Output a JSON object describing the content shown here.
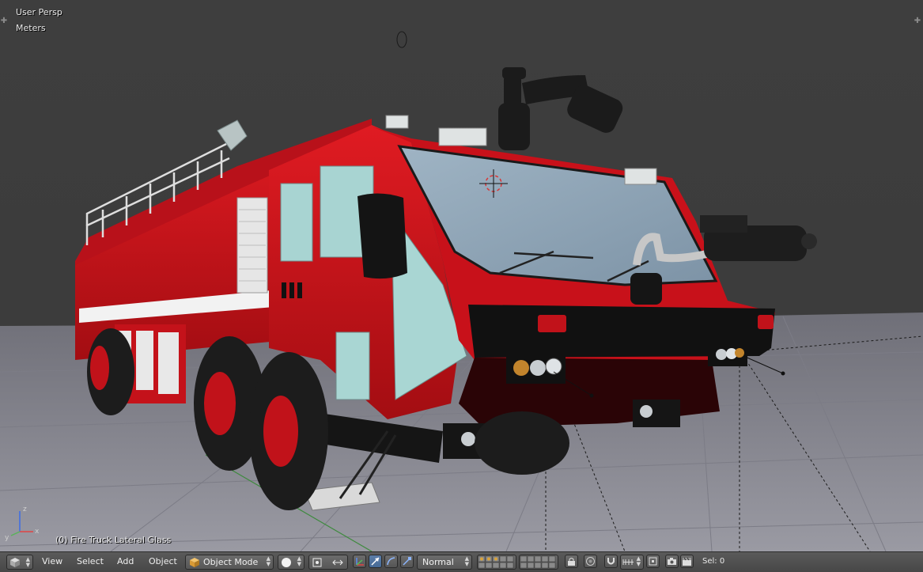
{
  "viewport": {
    "perspective_label": "User Persp",
    "units_label": "Meters",
    "object_label": "(0) Fire Truck Lateral Glass",
    "axis_labels": {
      "x": "x",
      "y": "y",
      "z": "z"
    }
  },
  "header": {
    "menu": {
      "view": "View",
      "select": "Select",
      "add": "Add",
      "object": "Object"
    },
    "mode_label": "Object Mode",
    "orientation_label": "Normal",
    "selection_count": "Sel: 0"
  },
  "icons": {
    "editor_type": "cube-icon",
    "viewport_shading": "sphere-icon",
    "pivot": "pivot-icon",
    "manipulator": "axis-icon",
    "translate": "arrow-icon",
    "rotate": "rotate-icon",
    "scale": "scale-icon",
    "layers": "layer-grid-icon",
    "lock": "lock-icon",
    "proportional": "circle-icon",
    "snap": "magnet-icon",
    "render": "camera-icon",
    "anim_render": "clapper-icon"
  },
  "colors": {
    "viewport_bg": "#3d3d3d",
    "floor": "#8a8a94",
    "truck_red": "#d0101a",
    "header_bg": "#4f4f4f",
    "active_blue": "#5680c2"
  }
}
